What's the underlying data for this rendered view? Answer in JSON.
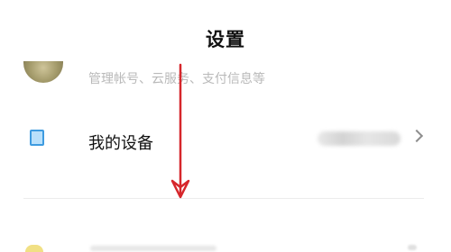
{
  "header": {
    "title": "设置"
  },
  "account": {
    "subtitle": "管理帐号、云服务、支付信息等"
  },
  "device_item": {
    "label": "我的设备",
    "chevron": "›"
  },
  "icons": {
    "avatar": "account-avatar",
    "device": "device-icon",
    "chevron": "chevron-right-icon",
    "annotation": "arrow-down-annotation"
  },
  "colors": {
    "annotation_arrow": "#d6262b",
    "device_icon_fill": "#b9e0fb",
    "device_icon_border": "#3e9be0"
  }
}
